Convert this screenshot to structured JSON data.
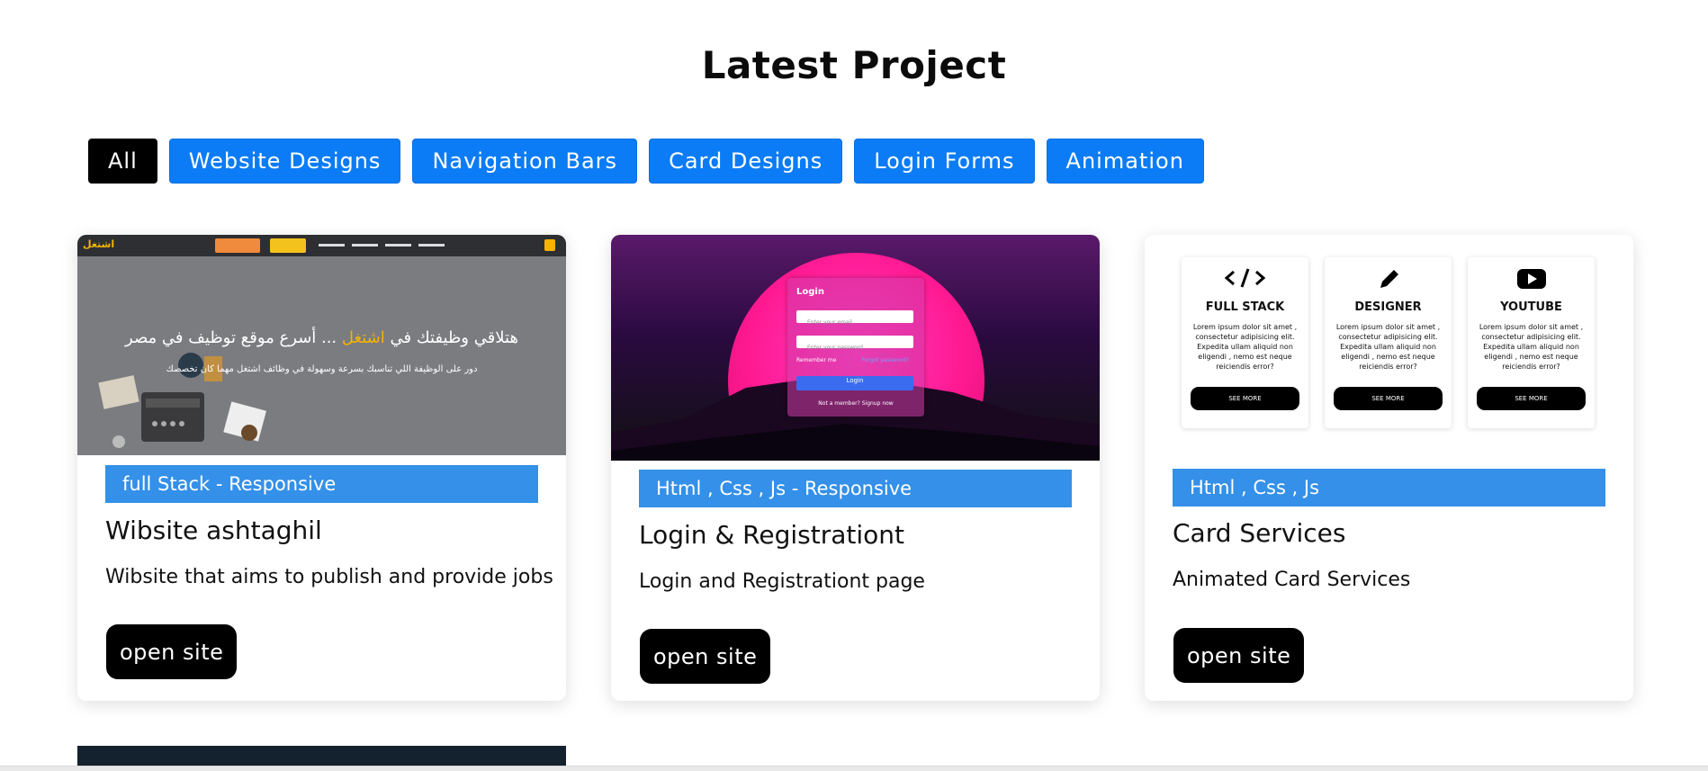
{
  "page_title": "Latest Project",
  "filters": [
    {
      "label": "All",
      "active": true
    },
    {
      "label": "Website Designs",
      "active": false
    },
    {
      "label": "Navigation Bars",
      "active": false
    },
    {
      "label": "Card Designs",
      "active": false
    },
    {
      "label": "Login Forms",
      "active": false
    },
    {
      "label": "Animation",
      "active": false
    }
  ],
  "projects": [
    {
      "tag": "full Stack - Responsive",
      "name": "Wibsite ashtaghil",
      "description": "Wibsite that aims to publish and provide jobs",
      "button": "open site",
      "thumb": {
        "logo": "اشتغل",
        "headline_pre": "هتلاقي وظيفتك في",
        "headline_brand": "اشتغل",
        "headline_post": "... أسرع موقع توظيف في مصر",
        "subline": "دور على الوظيفة اللي تناسبك بسرعة وسهولة في وظائف اشتغل مهما كان تخصصك"
      }
    },
    {
      "tag": "Html , Css , Js - Responsive",
      "name": "Login & Registrationt",
      "description": "Login and Registrationt page",
      "button": "open site",
      "thumb": {
        "form_title": "Login",
        "email_placeholder": "Enter your email",
        "password_placeholder": "Enter your password",
        "remember": "Remember me",
        "forgot": "Forgot password?",
        "submit": "Login",
        "footer": "Not a member? Signup now"
      }
    },
    {
      "tag": "Html , Css , Js",
      "name": "Card Services",
      "description": "Animated Card Services",
      "button": "open site",
      "thumb": {
        "cards": [
          {
            "icon": "code-icon",
            "title": "FULL STACK",
            "text": "Lorem ipsum dolor sit amet , consectetur adipisicing elit. Expedita ullam aliquid non eligendi , nemo est neque reiciendis error?",
            "button": "SEE MORE"
          },
          {
            "icon": "pencil-icon",
            "title": "DESIGNER",
            "text": "Lorem ipsum dolor sit amet , consectetur adipisicing elit. Expedita ullam aliquid non eligendi , nemo est neque reiciendis error?",
            "button": "SEE MORE"
          },
          {
            "icon": "youtube-icon",
            "title": "YOUTUBE",
            "text": "Lorem ipsum dolor sit amet , consectetur adipisicing elit. Expedita ullam aliquid non eligendi , nemo est neque reiciendis error?",
            "button": "SEE MORE"
          }
        ]
      }
    }
  ],
  "colors": {
    "accent": "#0b7cf5",
    "tag": "#3490e8",
    "active_filter": "#000000"
  }
}
